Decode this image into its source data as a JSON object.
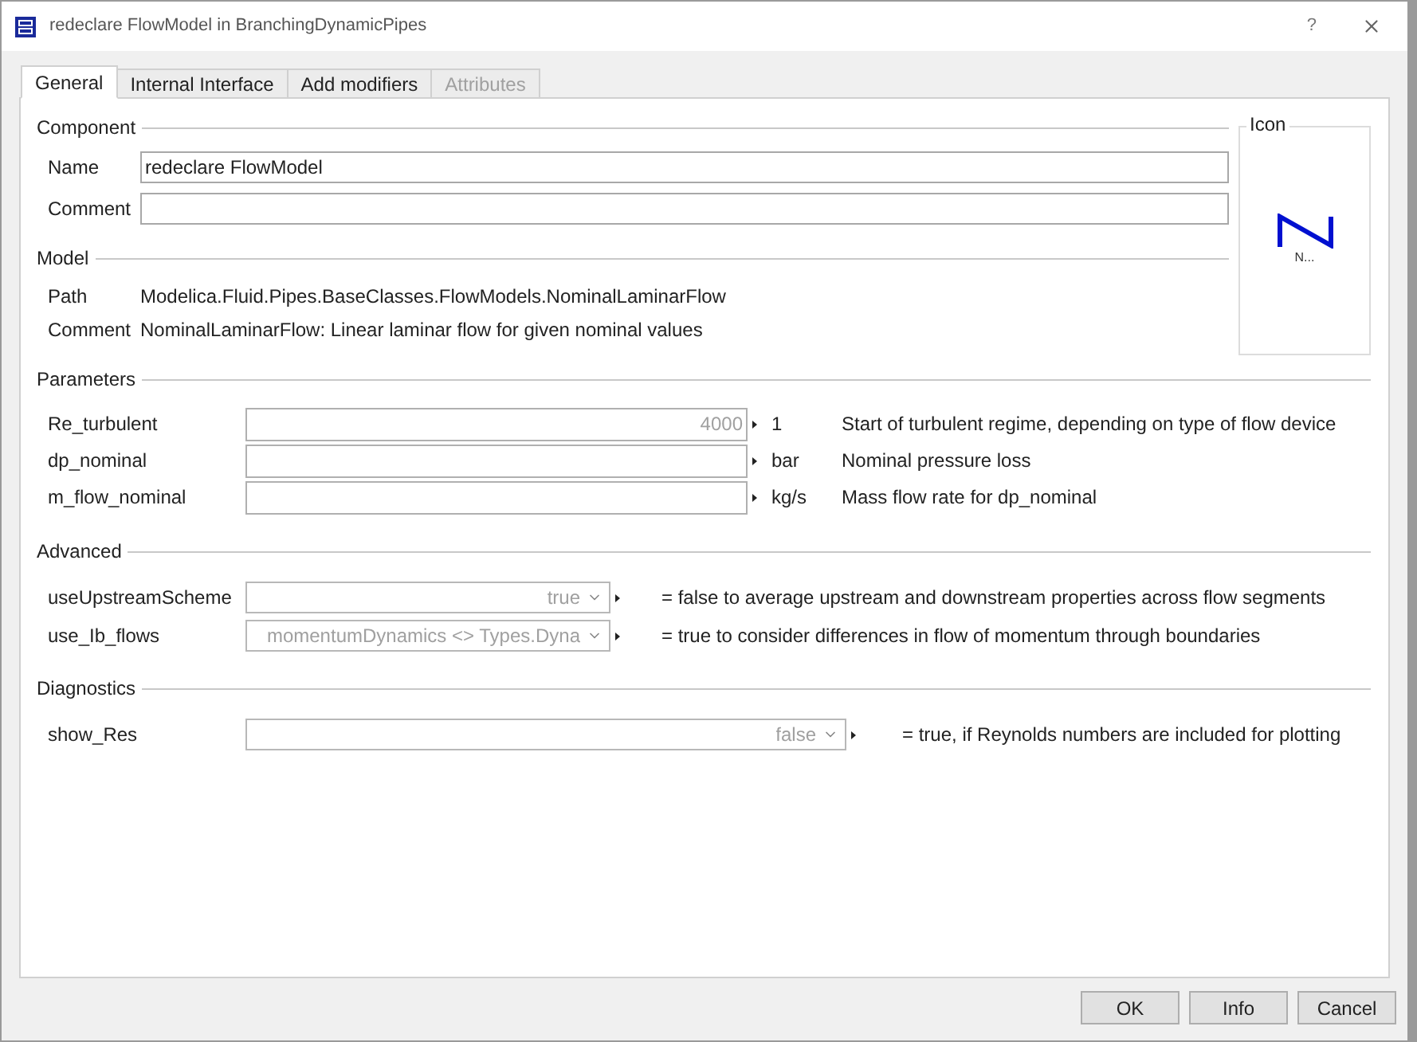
{
  "window": {
    "title": "redeclare FlowModel in BranchingDynamicPipes",
    "help": "?"
  },
  "tabs": [
    {
      "label": "General",
      "selected": true,
      "disabled": false
    },
    {
      "label": "Internal Interface",
      "selected": false,
      "disabled": false
    },
    {
      "label": "Add modifiers",
      "selected": false,
      "disabled": false
    },
    {
      "label": "Attributes",
      "selected": false,
      "disabled": true
    }
  ],
  "component": {
    "title": "Component",
    "fields": [
      {
        "label": "Name",
        "value": "redeclare FlowModel"
      },
      {
        "label": "Comment"
      }
    ]
  },
  "model": {
    "title": "Model",
    "rows": [
      {
        "label": "Path",
        "text": "Modelica.Fluid.Pipes.BaseClasses.FlowModels.NominalLaminarFlow"
      },
      {
        "label": "Comment",
        "text": "NominalLaminarFlow: Linear laminar flow for given nominal values"
      }
    ]
  },
  "icon_panel": {
    "title": "Icon",
    "caption": "N..."
  },
  "parameters": {
    "title": "Parameters",
    "rows": [
      {
        "label": "Re_turbulent",
        "placeholder": "4000",
        "unit": "1",
        "description": "Start of turbulent regime, depending on type of flow device"
      },
      {
        "label": "dp_nominal",
        "unit": "bar",
        "description": "Nominal pressure loss"
      },
      {
        "label": "m_flow_nominal",
        "unit": "kg/s",
        "description": "Mass flow rate for dp_nominal"
      }
    ]
  },
  "advanced": {
    "title": "Advanced",
    "rows": [
      {
        "label": "useUpstreamScheme",
        "placeholder": "true",
        "description": "= false to average upstream and downstream properties across flow segments"
      },
      {
        "label": "use_Ib_flows",
        "placeholder": "momentumDynamics <> Types.Dyna",
        "description": "= true to consider differences in flow of momentum through boundaries"
      }
    ]
  },
  "diagnostics": {
    "title": "Diagnostics",
    "rows": [
      {
        "label": "show_Res",
        "placeholder": "false",
        "description": "= true, if Reynolds numbers are included for plotting"
      }
    ]
  },
  "buttons": [
    "OK",
    "Info",
    "Cancel"
  ]
}
